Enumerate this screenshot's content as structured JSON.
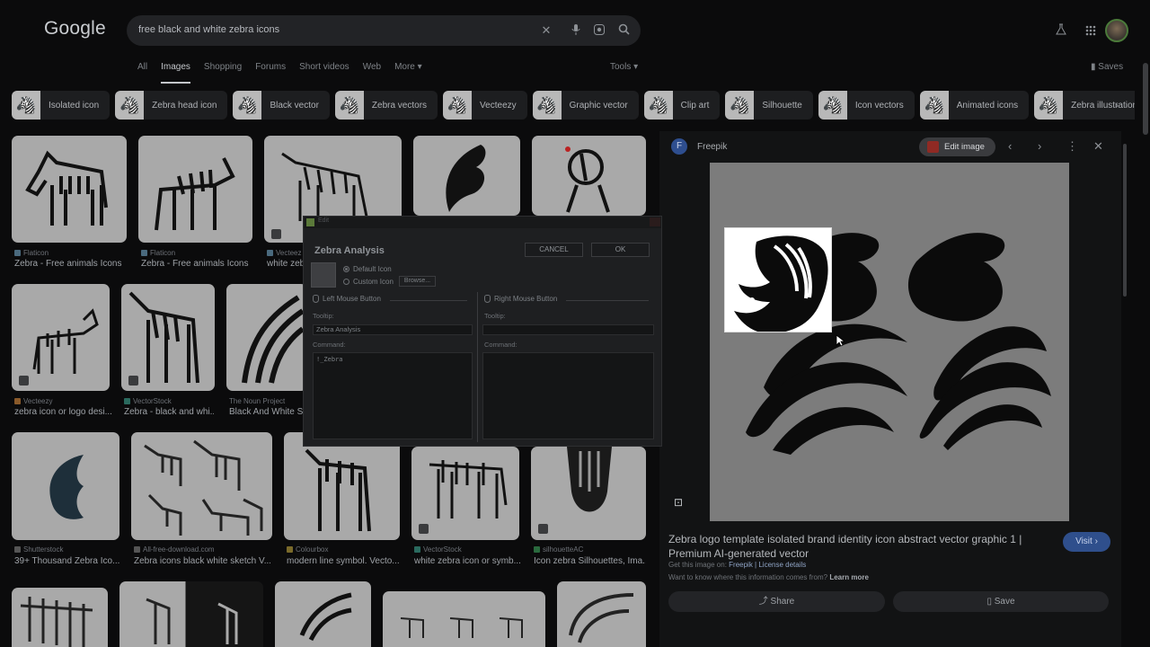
{
  "header": {
    "logo": "Google",
    "search_query": "free black and white zebra icons"
  },
  "tabs": [
    {
      "label": "All",
      "active": false
    },
    {
      "label": "Images",
      "active": true
    },
    {
      "label": "Shopping",
      "active": false
    },
    {
      "label": "Forums",
      "active": false
    },
    {
      "label": "Short videos",
      "active": false
    },
    {
      "label": "Web",
      "active": false
    },
    {
      "label": "More ▾",
      "active": false
    }
  ],
  "tools_label": "Tools ▾",
  "saves_label": "Saves",
  "chips": [
    "Isolated icon",
    "Zebra head icon",
    "Black vector",
    "Zebra vectors",
    "Vecteezy",
    "Graphic vector",
    "Clip art",
    "Silhouette",
    "Icon vectors",
    "Animated icons",
    "Zebra illustration"
  ],
  "results": [
    {
      "source": "Flaticon",
      "title": "Zebra - Free animals Icons"
    },
    {
      "source": "Flaticon",
      "title": "Zebra - Free animals Icons"
    },
    {
      "source": "Vecteez",
      "title": "white zeb"
    },
    {
      "source": "Vecteezy",
      "title": "zebra icon or logo desi..."
    },
    {
      "source": "VectorStock",
      "title": "Zebra - black and whi..."
    },
    {
      "source": "The Noun Project",
      "title": "Black And White St"
    },
    {
      "source": "Shutterstock",
      "title": "39+ Thousand Zebra Ico..."
    },
    {
      "source": "All-free-download.com",
      "title": "Zebra icons black white sketch V..."
    },
    {
      "source": "Colourbox",
      "title": "modern line symbol. Vecto..."
    },
    {
      "source": "VectorStock",
      "title": "white zebra icon or symb..."
    },
    {
      "source": "silhouetteAC",
      "title": "Icon zebra Silhouettes, Ima..."
    }
  ],
  "preview": {
    "source": "Freepik",
    "edit_label": "Edit image",
    "title": "Zebra logo template isolated brand identity icon abstract vector graphic 1 | Premium AI-generated vector",
    "get_prefix": "Get this image on:",
    "get_site": "Freepik | License details",
    "learn_prefix": "Want to know where this information comes from?",
    "learn_link": "Learn more",
    "visit_label": "Visit ›",
    "share_label": "Share",
    "save_label": "Save"
  },
  "dialog": {
    "window_title": "Edit",
    "heading": "Zebra Analysis",
    "cancel_label": "CANCEL",
    "ok_label": "OK",
    "default_icon": "Default Icon",
    "custom_icon": "Custom Icon",
    "browse_label": "Browse...",
    "left_section": "Left Mouse Button",
    "right_section": "Right Mouse Button",
    "tooltip_label": "Tooltip:",
    "command_label": "Command:",
    "left_tooltip": "Zebra Analysis",
    "left_command": "!_Zebra",
    "right_tooltip": "",
    "right_command": ""
  }
}
